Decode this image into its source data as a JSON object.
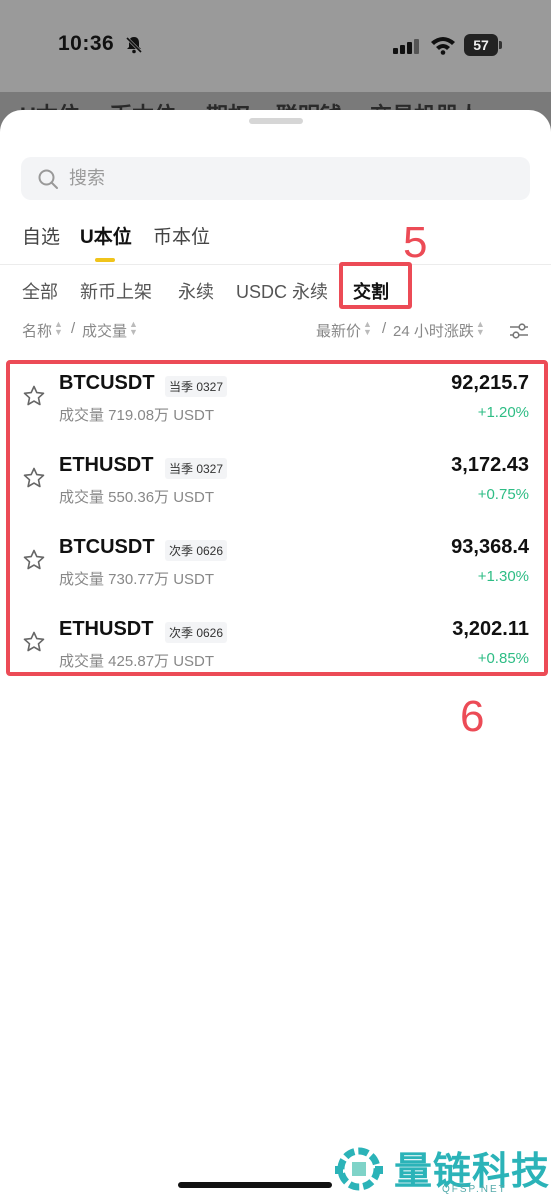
{
  "status_bar": {
    "time": "10:36",
    "battery": "57"
  },
  "behind_tabs": [
    "U本位",
    "币本位",
    "期权",
    "联明钱",
    "交易机器人"
  ],
  "search": {
    "placeholder": "搜索"
  },
  "tabs_primary": [
    {
      "label": "自选",
      "active": false
    },
    {
      "label": "U本位",
      "active": true
    },
    {
      "label": "币本位",
      "active": false
    }
  ],
  "tabs_secondary": [
    {
      "label": "全部",
      "active": false
    },
    {
      "label": "新币上架",
      "active": false
    },
    {
      "label": "永续",
      "active": false
    },
    {
      "label": "USDC 永续",
      "active": false
    },
    {
      "label": "交割",
      "active": true
    }
  ],
  "sort_header": {
    "name": "名称",
    "sep1": "/",
    "volume": "成交量",
    "last_price": "最新价",
    "sep2": "/",
    "change_24h": "24 小时涨跌"
  },
  "annotations": {
    "step5": "5",
    "step6": "6"
  },
  "contracts": [
    {
      "symbol": "BTCUSDT",
      "tag": "当季 0327",
      "volume": "成交量 719.08万 USDT",
      "price": "92,215.7",
      "change": "+1.20%"
    },
    {
      "symbol": "ETHUSDT",
      "tag": "当季 0327",
      "volume": "成交量 550.36万 USDT",
      "price": "3,172.43",
      "change": "+0.75%"
    },
    {
      "symbol": "BTCUSDT",
      "tag": "次季 0626",
      "volume": "成交量 730.77万 USDT",
      "price": "93,368.4",
      "change": "+1.30%"
    },
    {
      "symbol": "ETHUSDT",
      "tag": "次季 0626",
      "volume": "成交量 425.87万 USDT",
      "price": "3,202.11",
      "change": "+0.85%"
    }
  ],
  "watermark": {
    "text": "量链科技",
    "sub": "QFSP.NET"
  },
  "colors": {
    "accent": "#f0c41b",
    "positive": "#2ebd85",
    "annotation": "#ec4b56"
  }
}
